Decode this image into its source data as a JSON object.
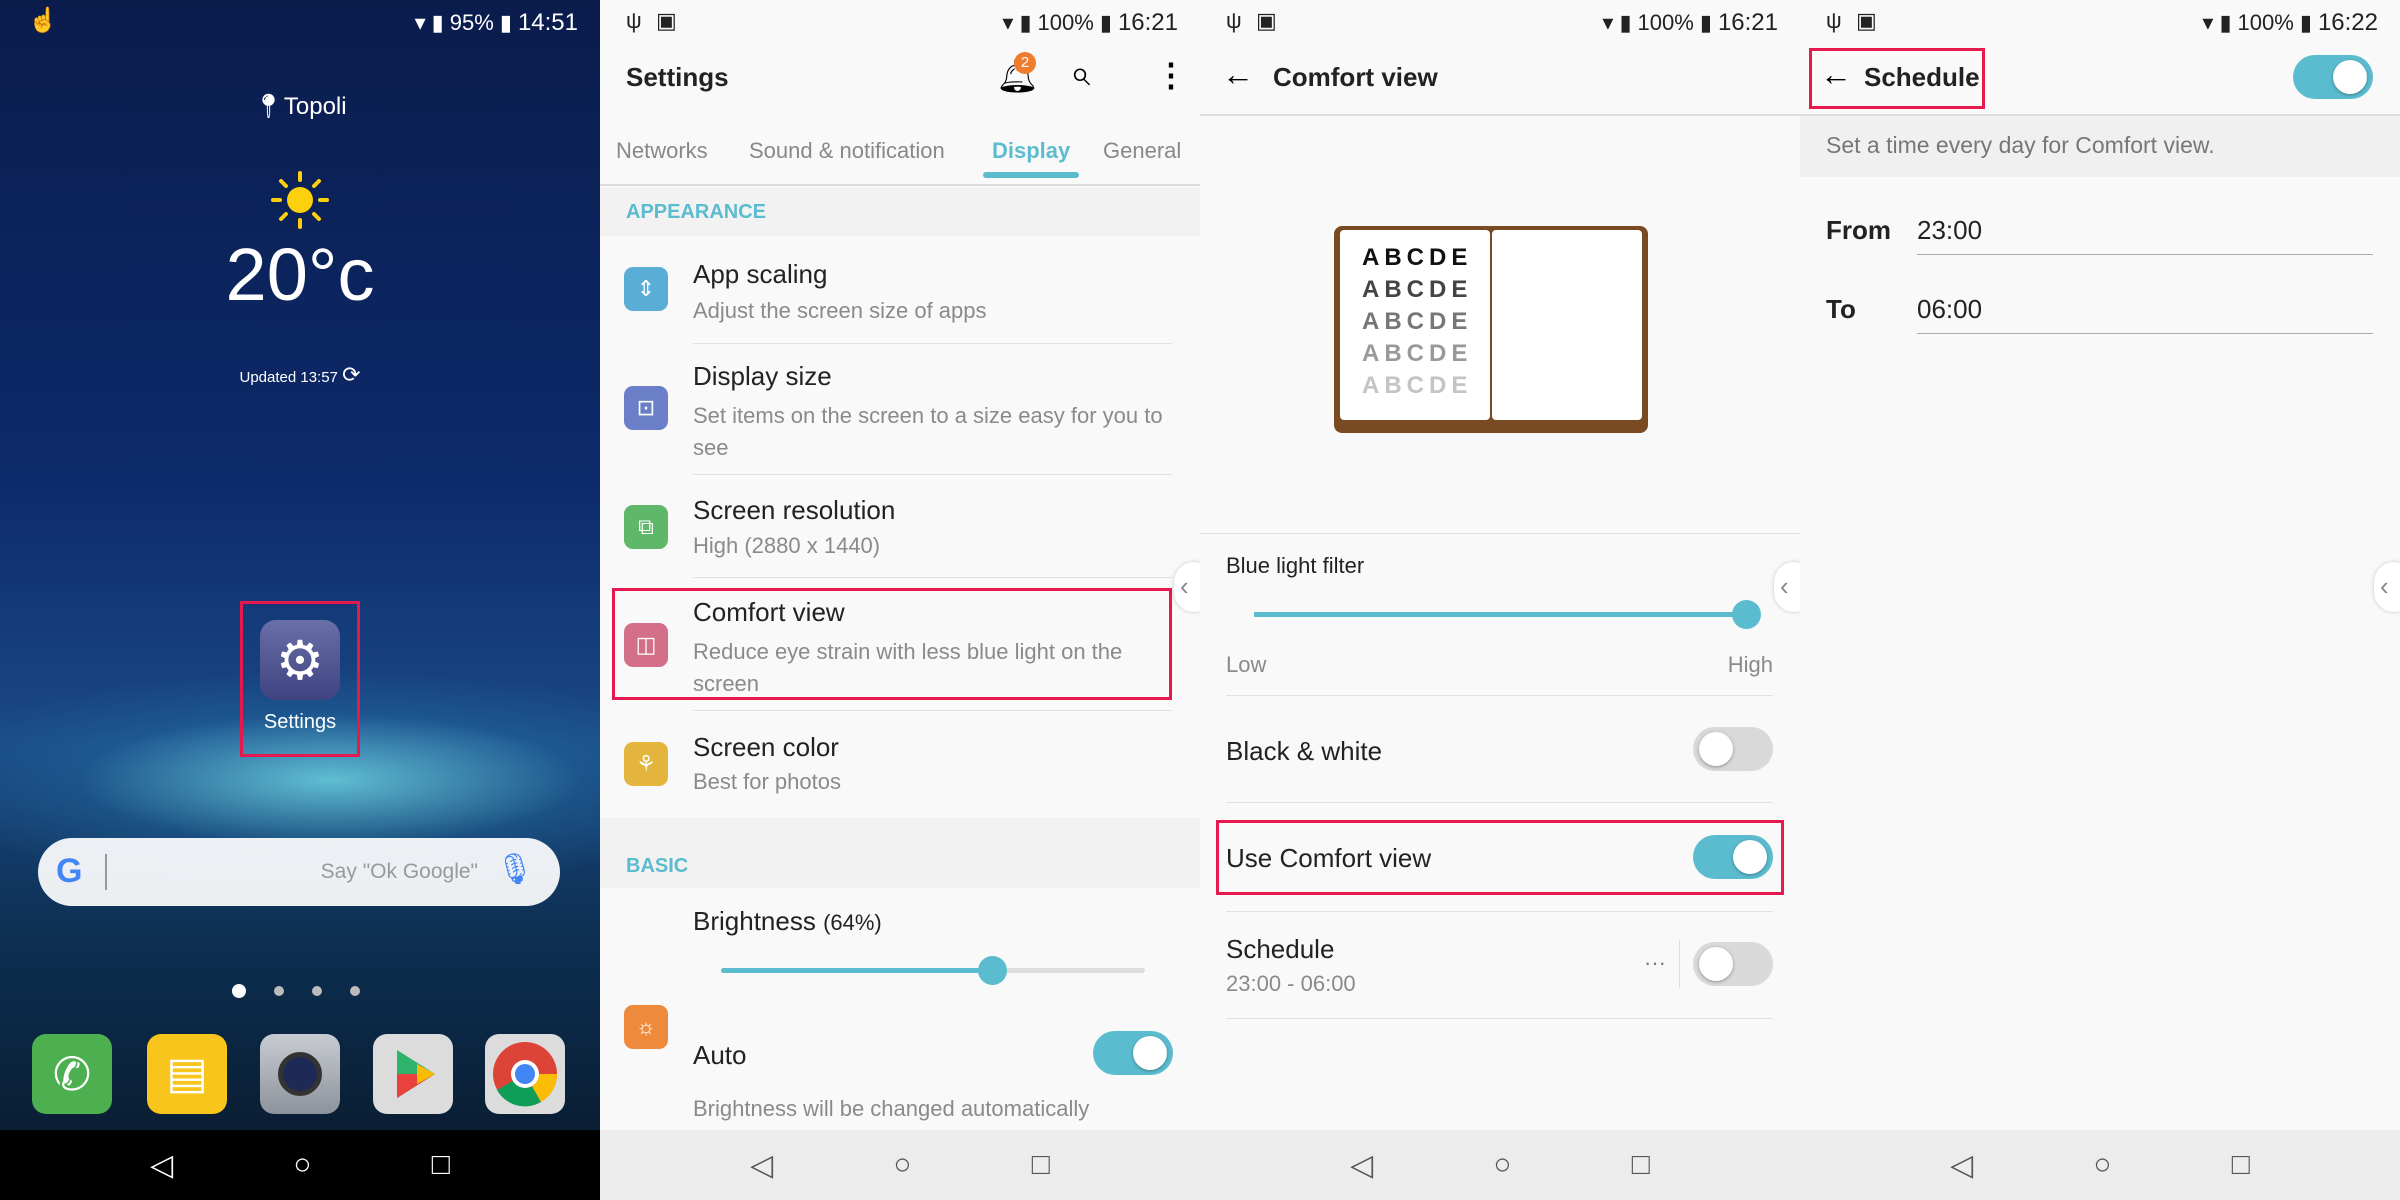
{
  "home": {
    "status": {
      "battery": "95%",
      "time": "14:51"
    },
    "weather": {
      "location": "Topoli",
      "temperature": "20°c",
      "updated": "Updated 13:57"
    },
    "app_icon": {
      "label": "Settings"
    },
    "search_bar": {
      "placeholder": "Say \"Ok Google\""
    },
    "dock": [
      "phone-icon",
      "messaging-icon",
      "camera-icon",
      "play-store-icon",
      "chrome-icon"
    ],
    "page_indicators": 4
  },
  "settings": {
    "status": {
      "battery": "100%",
      "time": "16:21"
    },
    "title": "Settings",
    "notification_count": "2",
    "tabs": [
      "Networks",
      "Sound & notification",
      "Display",
      "General"
    ],
    "active_tab": "Display",
    "sections": {
      "appearance": "APPEARANCE",
      "basic": "BASIC"
    },
    "items": [
      {
        "title": "App scaling",
        "subtitle": "Adjust the screen size of apps",
        "color": "#5aaed6"
      },
      {
        "title": "Display size",
        "subtitle": "Set items on the screen to a size easy for you to see",
        "color": "#6b7fc9"
      },
      {
        "title": "Screen resolution",
        "subtitle": "High (2880 x 1440)",
        "color": "#5fb86a"
      },
      {
        "title": "Comfort view",
        "subtitle": "Reduce eye strain with less blue light on the screen",
        "color": "#d46f8a"
      },
      {
        "title": "Screen color",
        "subtitle": "Best for photos",
        "color": "#e3b53c"
      }
    ],
    "brightness": {
      "label": "Brightness",
      "percent_label": "(64%)",
      "value": 64
    },
    "auto": {
      "label": "Auto",
      "on": true,
      "description": "Brightness will be changed automatically"
    }
  },
  "comfort": {
    "status": {
      "battery": "100%",
      "time": "16:21"
    },
    "title": "Comfort view",
    "illustration_letters": [
      "ABCDE",
      "ABCDE",
      "ABCDE",
      "ABCDE",
      "ABCDE"
    ],
    "blue_light": {
      "label": "Blue light filter",
      "low": "Low",
      "high": "High",
      "value": 100
    },
    "black_white": {
      "label": "Black & white",
      "on": false
    },
    "use_comfort": {
      "label": "Use Comfort view",
      "on": true
    },
    "schedule": {
      "label": "Schedule",
      "value": "23:00 - 06:00",
      "more": "···",
      "on": false
    }
  },
  "schedule": {
    "status": {
      "battery": "100%",
      "time": "16:22"
    },
    "title": "Schedule",
    "on": true,
    "description": "Set a time every day for Comfort view.",
    "from": {
      "label": "From",
      "value": "23:00"
    },
    "to": {
      "label": "To",
      "value": "06:00"
    }
  },
  "colors": {
    "accent": "#5bbccf",
    "highlight": "#e5194e",
    "badge": "#f07c2e"
  }
}
